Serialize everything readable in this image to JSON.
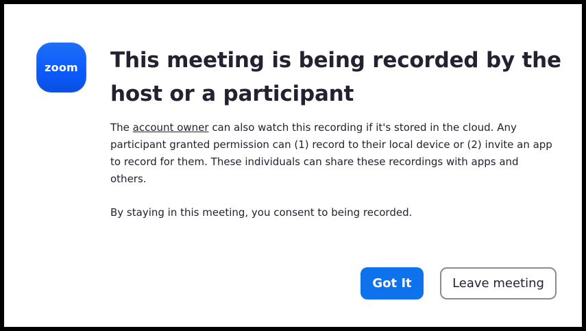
{
  "dialog": {
    "logo_text": "zoom",
    "title": "This meeting is being recorded by the host or a participant",
    "body": {
      "prefix": "The ",
      "link_text": "account owner",
      "suffix": " can also watch this recording if it's stored in the cloud. Any participant granted permission can (1) record to their local device or (2) invite an app to record for them. These individuals can share these recordings with apps and others."
    },
    "consent_text": "By staying in this meeting, you consent to being recorded.",
    "buttons": {
      "primary_label": "Got It",
      "secondary_label": "Leave meeting"
    }
  },
  "colors": {
    "brand_blue": "#0b5cff",
    "button_blue": "#0e72ed",
    "text": "#222230",
    "secondary_border": "#8a8a94"
  }
}
